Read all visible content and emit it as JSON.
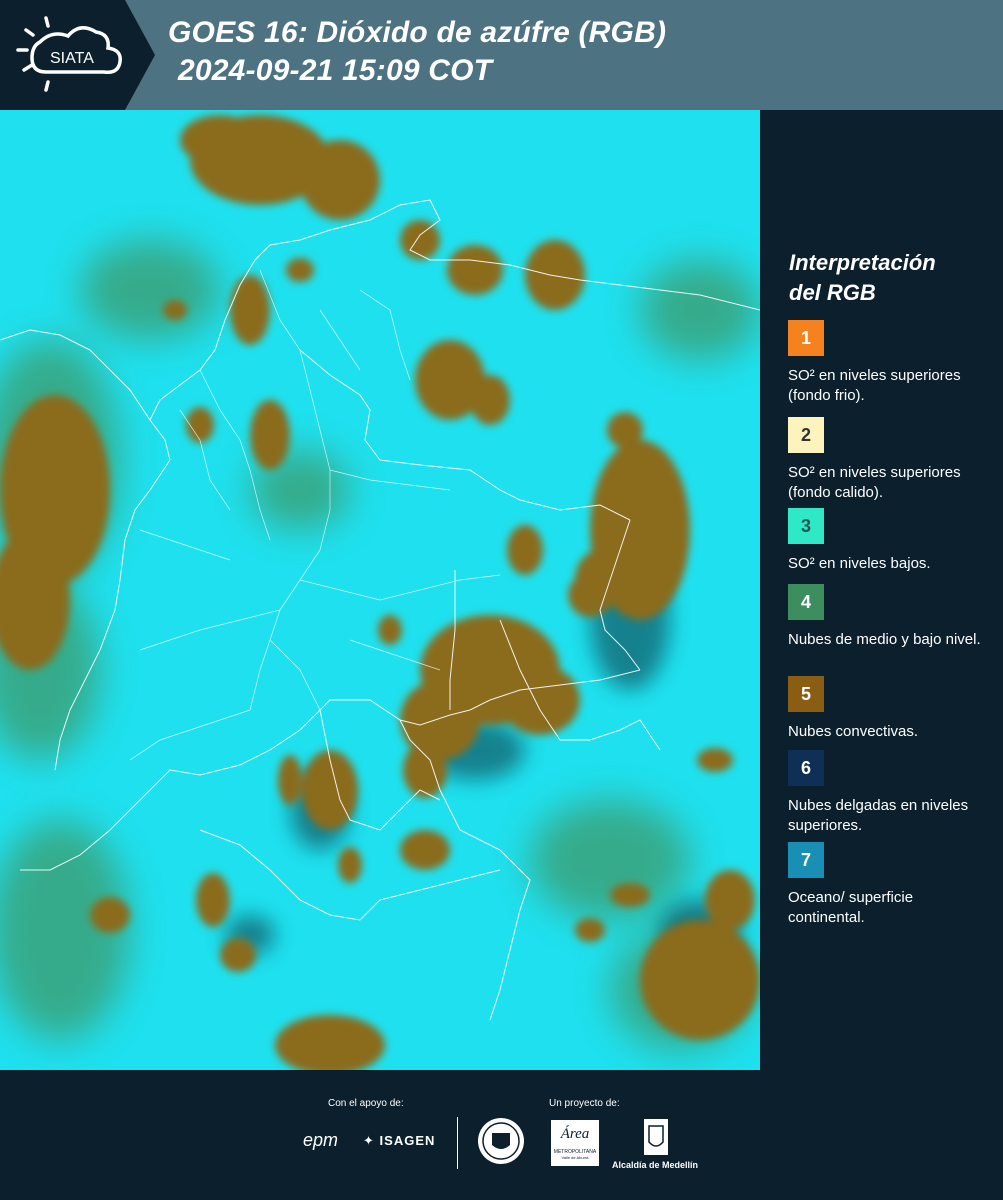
{
  "header": {
    "brand": "SIATA",
    "title_line1": "GOES 16: Dióxido de azúfre (RGB)",
    "title_line2": "2024-09-21 15:09 COT"
  },
  "map": {
    "background_color": "#1fe0ee",
    "cloud_color": "#8a6c1f",
    "low_level_color": "#3e9a6a",
    "border_color": "#ffffff"
  },
  "legend": {
    "title_line1": "Interpretación",
    "title_line2": "del RGB",
    "items": [
      {
        "number": "1",
        "color": "#f5821f",
        "text": "SO² en niveles superiores (fondo frio)."
      },
      {
        "number": "2",
        "color": "#fdf4bd",
        "text": "SO² en niveles superiores (fondo calido)."
      },
      {
        "number": "3",
        "color": "#2fe8c6",
        "text": "SO² en niveles bajos."
      },
      {
        "number": "4",
        "color": "#3d8e5f",
        "text": "Nubes de medio y bajo nivel."
      },
      {
        "number": "5",
        "color": "#8b5d13",
        "text": "Nubes convectivas."
      },
      {
        "number": "6",
        "color": "#0f2f57",
        "text": "Nubes delgadas en niveles superiores."
      },
      {
        "number": "7",
        "color": "#1a8fb5",
        "text": "Oceano/ superficie continental."
      }
    ]
  },
  "footer": {
    "support_label": "Con el apoyo de:",
    "project_label": "Un proyecto de:",
    "epm": "epm",
    "isagen": "ISAGEN",
    "area_name": "Área",
    "area_sub1": "METROPOLITANA",
    "area_sub2": "Valle de Aburrá",
    "alcaldia": "Alcaldía de Medellín"
  }
}
